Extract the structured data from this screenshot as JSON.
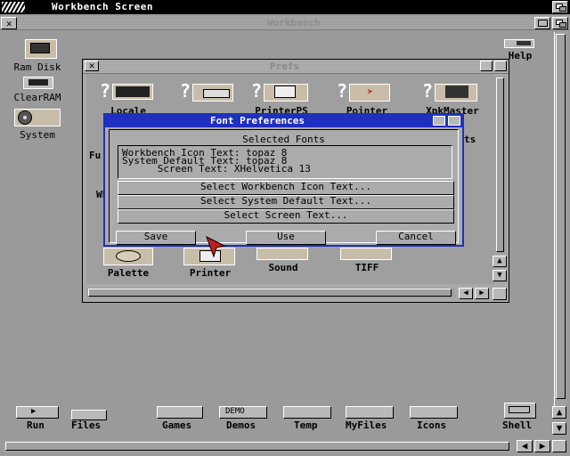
{
  "screen": {
    "title": "Workbench Screen"
  },
  "workbench_window": {
    "title": "Workbench"
  },
  "desktop_icons": [
    {
      "label": "Ram Disk",
      "icon": "ram-disk-icon"
    },
    {
      "label": "ClearRAM",
      "icon": "clearram-icon"
    },
    {
      "label": "System",
      "icon": "system-disk-icon"
    },
    {
      "label": "Help",
      "icon": "help-icon"
    }
  ],
  "drawer": {
    "title": "Prefs",
    "row1": [
      "Locale",
      "PrinterPS",
      "Pointer",
      "XpkMaster"
    ],
    "row2": [
      "Palette",
      "Printer",
      "Sound",
      "TIFF"
    ],
    "partial": [
      "Fu",
      "WE",
      "ts"
    ]
  },
  "font_prefs": {
    "title": "Font Preferences",
    "section_label": "Selected Fonts",
    "lines": [
      "Workbench Icon Text: topaz 8",
      "System Default Text: topaz 8",
      "      Screen Text: XHelvetica 13"
    ],
    "select_buttons": [
      "Select Workbench Icon Text...",
      "Select System Default Text...",
      "Select Screen Text..."
    ],
    "save": "Save",
    "use": "Use",
    "cancel": "Cancel"
  },
  "dock": [
    "Run",
    "Files",
    "Games",
    "Demos",
    "Temp",
    "MyFiles",
    "Icons",
    "Shell"
  ],
  "dock_badge": "DEMO"
}
